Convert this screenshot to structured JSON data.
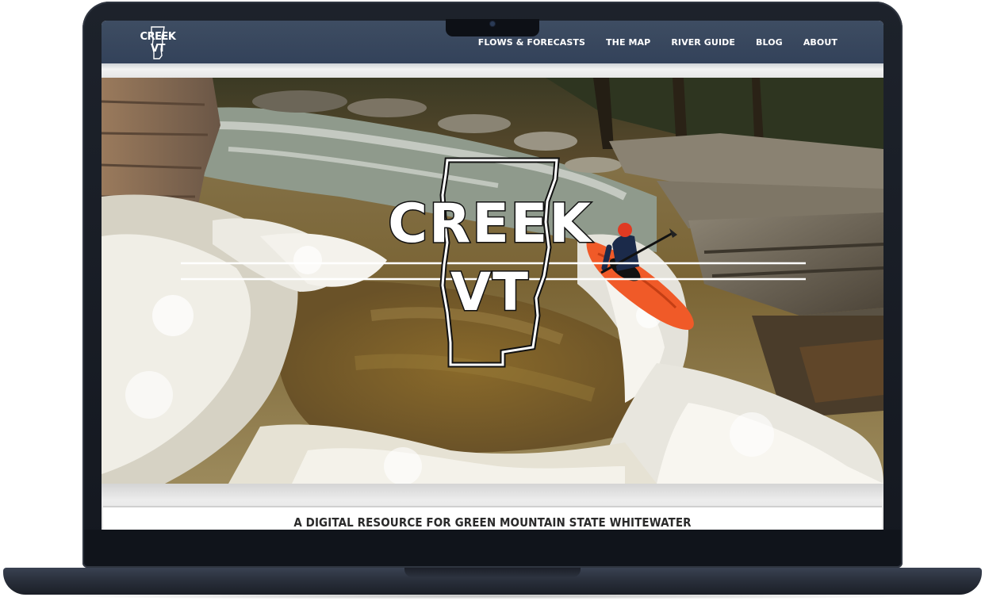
{
  "site": {
    "logo_line1": "CREEK",
    "logo_line2": "VT"
  },
  "nav": {
    "items": [
      {
        "label": "FLOWS & FORECASTS"
      },
      {
        "label": "THE MAP"
      },
      {
        "label": "RIVER GUIDE"
      },
      {
        "label": "BLOG"
      },
      {
        "label": "ABOUT"
      }
    ]
  },
  "hero": {
    "logo_line1": "CREEK",
    "logo_line2": "VT"
  },
  "tagline": "A DIGITAL RESOURCE FOR GREEN MOUNTAIN STATE WHITEWATER",
  "colors": {
    "navbar": "#3a4960",
    "laptop": "#1a1f28",
    "kayak": "#f05a28"
  }
}
